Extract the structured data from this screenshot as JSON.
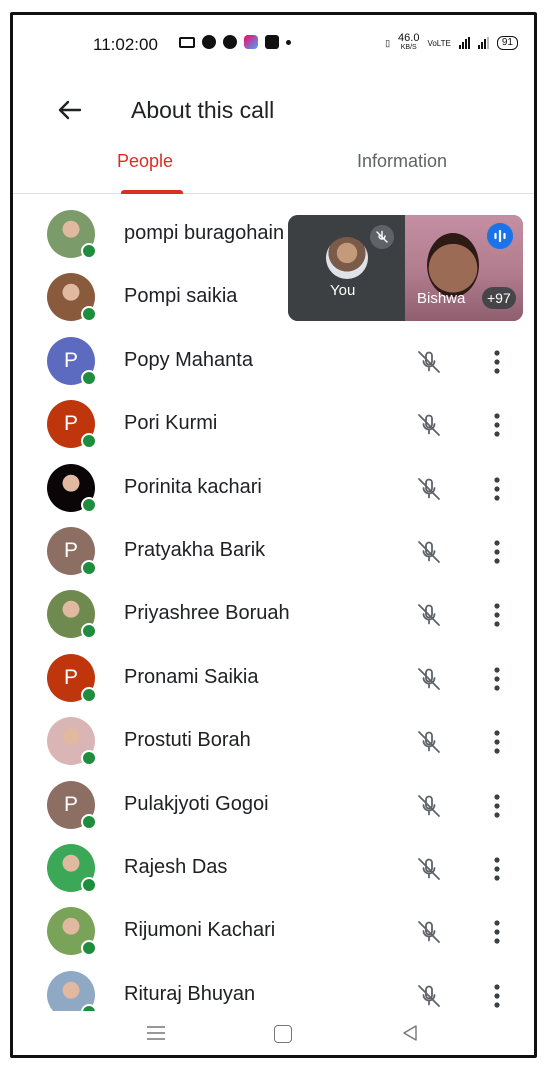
{
  "status_bar": {
    "time": "11:02:00",
    "net_speed_value": "46.0",
    "net_speed_unit": "KB/S",
    "battery": "91"
  },
  "header": {
    "title": "About this call",
    "back_icon": "arrow-left-icon"
  },
  "tabs": [
    {
      "label": "People",
      "active": true
    },
    {
      "label": "Information",
      "active": false
    }
  ],
  "pip": {
    "self_label": "You",
    "other_name": "Bishwa",
    "extra_count": "+97"
  },
  "participants": [
    {
      "name": "pompi buragohain",
      "initial": "",
      "avatar_color": "#7c9b6a",
      "photo": true,
      "muted": true
    },
    {
      "name": "Pompi saikia",
      "initial": "",
      "avatar_color": "#8a5a3c",
      "photo": true,
      "muted": true
    },
    {
      "name": "Popy Mahanta",
      "initial": "P",
      "avatar_color": "#5c6bc0",
      "photo": false,
      "muted": true
    },
    {
      "name": "Pori Kurmi",
      "initial": "P",
      "avatar_color": "#c0360c",
      "photo": false,
      "muted": true
    },
    {
      "name": "Porinita kachari",
      "initial": "",
      "avatar_color": "#0a0506",
      "photo": true,
      "muted": true
    },
    {
      "name": "Pratyakha Barik",
      "initial": "P",
      "avatar_color": "#8d6e63",
      "photo": false,
      "muted": true
    },
    {
      "name": "Priyashree Boruah",
      "initial": "",
      "avatar_color": "#6f8a4e",
      "photo": true,
      "muted": true
    },
    {
      "name": "Pronami Saikia",
      "initial": "P",
      "avatar_color": "#c0360c",
      "photo": false,
      "muted": true
    },
    {
      "name": "Prostuti Borah",
      "initial": "",
      "avatar_color": "#d9b5b5",
      "photo": true,
      "muted": true
    },
    {
      "name": "Pulakjyoti Gogoi",
      "initial": "P",
      "avatar_color": "#8d6e63",
      "photo": false,
      "muted": true
    },
    {
      "name": "Rajesh Das",
      "initial": "",
      "avatar_color": "#3aa857",
      "photo": true,
      "muted": true
    },
    {
      "name": "Rijumoni Kachari",
      "initial": "",
      "avatar_color": "#7aa35a",
      "photo": true,
      "muted": true
    },
    {
      "name": "Rituraj Bhuyan",
      "initial": "",
      "avatar_color": "#8fa9c4",
      "photo": true,
      "muted": true
    }
  ],
  "colors": {
    "accent": "#d93025",
    "online": "#1e8e3e",
    "text": "#202124",
    "icon": "#5f6368"
  }
}
